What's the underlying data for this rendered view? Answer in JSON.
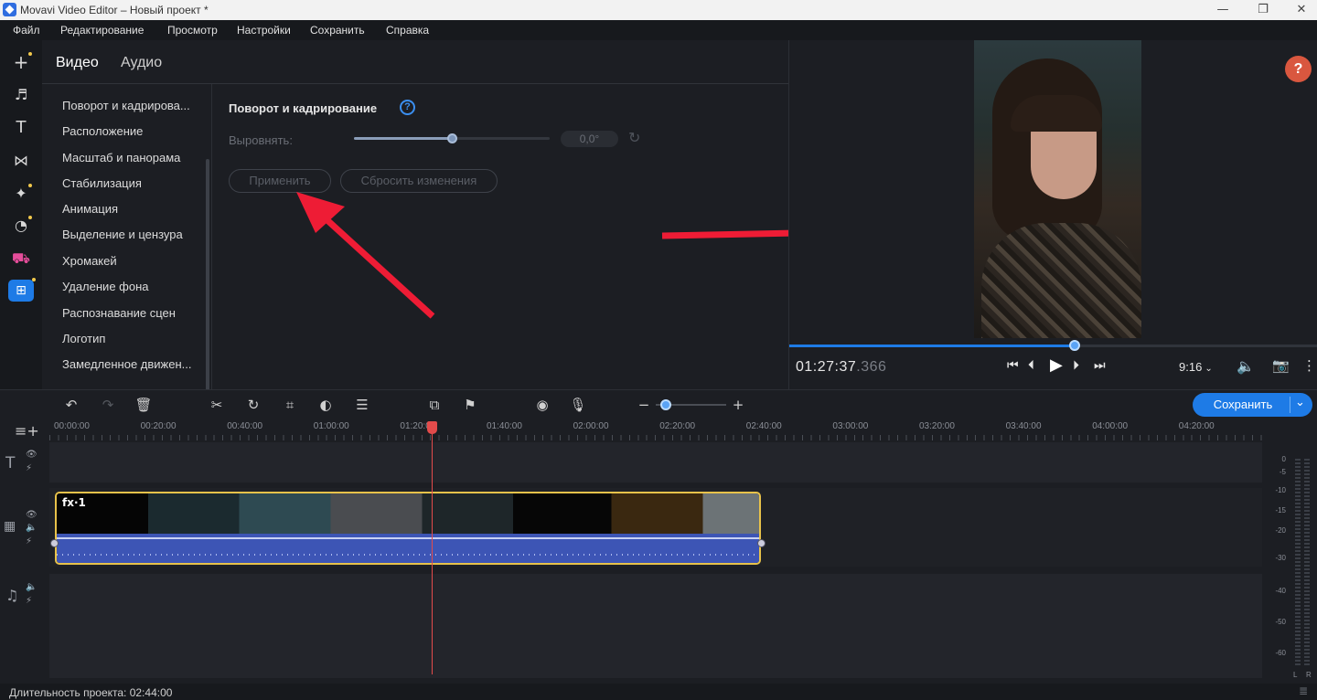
{
  "window": {
    "title": "Movavi Video Editor – Новый проект *",
    "minimize": "—",
    "maximize": "❐",
    "close": "✕"
  },
  "menu": [
    "Файл",
    "Редактирование",
    "Просмотр",
    "Настройки",
    "Сохранить",
    "Справка"
  ],
  "sidebar": {
    "icons": [
      "add-icon",
      "music-icon",
      "text-icon",
      "transitions-icon",
      "effects-icon",
      "stickers-icon",
      "store-icon",
      "more-tools-icon"
    ]
  },
  "tabs": {
    "video": "Видео",
    "audio": "Аудио"
  },
  "tools": [
    "Поворот и кадрирова...",
    "Расположение",
    "Масштаб и панорама",
    "Стабилизация",
    "Анимация",
    "Выделение и цензура",
    "Хромакей",
    "Удаление фона",
    "Распознавание сцен",
    "Логотип",
    "Замедленное движен..."
  ],
  "settings": {
    "title": "Поворот и кадрирование",
    "help": "?",
    "straighten_label": "Выровнять:",
    "straighten_value": "0,0°",
    "straighten_level": 0.5,
    "apply": "Применить",
    "reset": "Сбросить изменения"
  },
  "preview": {
    "help_button": "?",
    "timecode_main": "01:27:37",
    "timecode_ms": ".366",
    "aspect": "9:16",
    "progress": 0.54
  },
  "toolbar": {
    "save": "Сохранить",
    "minus": "−",
    "plus": "+"
  },
  "ruler": [
    "00:00:00",
    "00:20:00",
    "00:40:00",
    "01:00:00",
    "01:20:00",
    "01:40:00",
    "02:00:00",
    "02:20:00",
    "02:40:00",
    "03:00:00",
    "03:20:00",
    "03:40:00",
    "04:00:00",
    "04:20:00"
  ],
  "clip": {
    "fx_label": "fx·1"
  },
  "vu": [
    "0",
    "-5",
    "-10",
    "-15",
    "-20",
    "-30",
    "-40",
    "-50",
    "-60"
  ],
  "vu_channels": [
    "L",
    "R"
  ],
  "status": {
    "duration": "Длительность проекта: 02:44:00"
  },
  "colors": {
    "accent": "#1e7be6",
    "playhead": "#e34b4b",
    "clip_border": "#e8c24a",
    "audio": "#3d55b5",
    "arrow": "#ee1c35"
  }
}
